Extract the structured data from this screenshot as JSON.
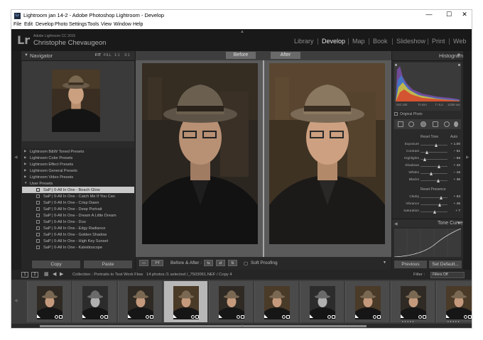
{
  "window": {
    "title": "Lightroom jan 14-2 - Adobe Photoshop Lightroom - Develop",
    "app_icon": "Lr",
    "controls": [
      "—",
      "☐",
      "✕"
    ]
  },
  "menu": [
    "File",
    "Edit",
    "Develop",
    "Photo",
    "Settings",
    "Tools",
    "View",
    "Window",
    "Help"
  ],
  "identity": {
    "logo": "Lr",
    "version": "Adobe Lightroom CC 2015",
    "user": "Christophe Chevaugeon"
  },
  "modules": [
    "Library",
    "Develop",
    "Map",
    "Book",
    "Slideshow",
    "Print",
    "Web"
  ],
  "active_module": "Develop",
  "navigator": {
    "title": "Navigator",
    "zoom": [
      "FIT",
      "FILL",
      "1:1",
      "3:1"
    ]
  },
  "presets": {
    "folders": [
      "Lightroom B&W Toned Presets",
      "Lightroom Color Presets",
      "Lightroom Effect Presets",
      "Lightroom General Presets",
      "Lightroom Video Presets",
      "User Presets"
    ],
    "items": [
      "SaP | 0-All In One - Beach Glow",
      "SaP | 0-All In One - Catch Me If You Can",
      "SaP | 0-All In One - Crisp Dawn",
      "SaP | 0-All In One - Deep Portrait",
      "SaP | 0-All In One - Dream A Little Dream",
      "SaP | 0-All In One - Duo",
      "SaP | 0-All In One - Edgy Radiance",
      "SaP | 0-All In One - Golden Shadow",
      "SaP | 0-All In One - High Key Sunset",
      "SaP | 0-All In One - Kaleidoscope"
    ],
    "selected_index": 0
  },
  "left_buttons": {
    "copy": "Copy",
    "paste": "Paste"
  },
  "view": {
    "before_label": "Before",
    "after_label": "After",
    "before_after_label": "Before & After :",
    "soft_proofing": "Soft Proofing",
    "yy_label": "YY"
  },
  "histogram": {
    "title": "Histogram",
    "info": [
      "ISO 100",
      "70 mm",
      "f / 6.3",
      "1/200 sec"
    ],
    "original_photo": "Original Photo"
  },
  "basic": {
    "reset_tone": "Reset Tone",
    "auto": "Auto",
    "reset_presence": "Reset Presence",
    "tone_sliders": [
      {
        "name": "Exposure",
        "value": "+ 1.00",
        "pos": 0.6
      },
      {
        "name": "Contrast",
        "value": "− 51",
        "pos": 0.25
      },
      {
        "name": "Highlights",
        "value": "− 69",
        "pos": 0.17
      },
      {
        "name": "Shadows",
        "value": "+ 42",
        "pos": 0.71
      },
      {
        "name": "Whites",
        "value": "− 16",
        "pos": 0.42
      },
      {
        "name": "Blacks",
        "value": "+ 36",
        "pos": 0.68
      }
    ],
    "presence_sliders": [
      {
        "name": "Clarity",
        "value": "+ 53",
        "pos": 0.77
      },
      {
        "name": "Vibrance",
        "value": "+ 45",
        "pos": 0.72
      },
      {
        "name": "Saturation",
        "value": "+ 7",
        "pos": 0.53
      }
    ]
  },
  "tone_curve": {
    "title": "Tone Curve"
  },
  "right_buttons": {
    "previous": "Previous",
    "set_default": "Set Default..."
  },
  "filmstrip_bar": {
    "monitor1": "1",
    "monitor2": "2",
    "collection": "Collection : Portraits to Test Work Flow",
    "count": "14 photos /1 selected /_7503061.NEF / Copy 4",
    "filter_label": "Filter :",
    "filter_value": "Filters Off"
  },
  "filmstrip": {
    "count": 10,
    "selected_index": 3,
    "bw_indices": [
      1,
      6
    ],
    "starred_indices": [
      8,
      9
    ]
  },
  "colors": {
    "accent": "#e6e6e6",
    "panel": "#2a2a2a",
    "background": "#1d1d1d",
    "selected": "#c9c9c9"
  }
}
